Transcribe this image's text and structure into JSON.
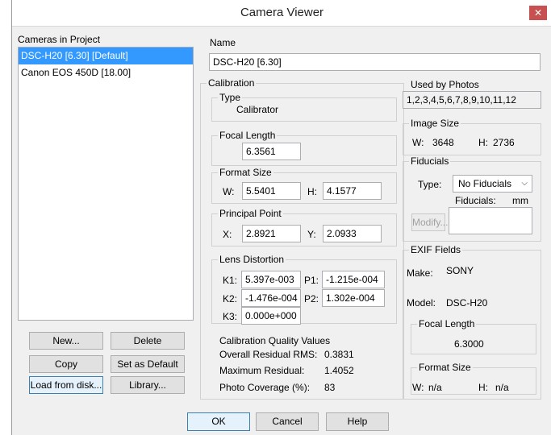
{
  "window": {
    "title": "Camera Viewer"
  },
  "cameras": {
    "group_title": "Cameras in Project",
    "items": [
      "DSC-H20 [6.30] [Default]",
      "Canon EOS 450D [18.00]"
    ],
    "buttons": {
      "new": "New...",
      "delete": "Delete",
      "copy": "Copy",
      "set_default": "Set as Default",
      "load": "Load from disk...",
      "library": "Library..."
    }
  },
  "name": {
    "label": "Name",
    "value": "DSC-H20 [6.30]"
  },
  "calibration": {
    "title": "Calibration",
    "type_label": "Type",
    "type_value": "Calibrator",
    "focal_label": "Focal Length",
    "focal_value": "6.3561",
    "format_label": "Format Size",
    "w_label": "W:",
    "w_value": "5.5401",
    "h_label": "H:",
    "h_value": "4.1577",
    "pp_label": "Principal Point",
    "x_label": "X:",
    "x_value": "2.8921",
    "y_label": "Y:",
    "y_value": "2.0933",
    "ld_label": "Lens Distortion",
    "k1_label": "K1:",
    "k1_value": "5.397e-003",
    "p1_label": "P1:",
    "p1_value": "-1.215e-004",
    "k2_label": "K2:",
    "k2_value": "-1.476e-004",
    "p2_label": "P2:",
    "p2_value": "1.302e-004",
    "k3_label": "K3:",
    "k3_value": "0.000e+000",
    "quality_label": "Calibration Quality Values",
    "rms_label": "Overall Residual RMS:",
    "rms_value": "0.3831",
    "maxres_label": "Maximum Residual:",
    "maxres_value": "1.4052",
    "coverage_label": "Photo Coverage (%):",
    "coverage_value": "83"
  },
  "used_by": {
    "label": "Used by Photos",
    "value": "1,2,3,4,5,6,7,8,9,10,11,12"
  },
  "image_size": {
    "label": "Image Size",
    "w_label": "W:",
    "w_value": "3648",
    "h_label": "H:",
    "h_value": "2736"
  },
  "fiducials": {
    "label": "Fiducials",
    "type_label": "Type:",
    "type_value": "No Fiducials",
    "units_label": "Fiducials:",
    "units_value": "mm",
    "modify": "Modify..."
  },
  "exif": {
    "label": "EXIF Fields",
    "make_label": "Make:",
    "make_value": "SONY",
    "model_label": "Model:",
    "model_value": "DSC-H20",
    "focal_label": "Focal Length",
    "focal_value": "6.3000",
    "format_label": "Format Size",
    "w_label": "W:",
    "w_value": "n/a",
    "h_label": "H:",
    "h_value": "n/a"
  },
  "footer": {
    "ok": "OK",
    "cancel": "Cancel",
    "help": "Help"
  }
}
